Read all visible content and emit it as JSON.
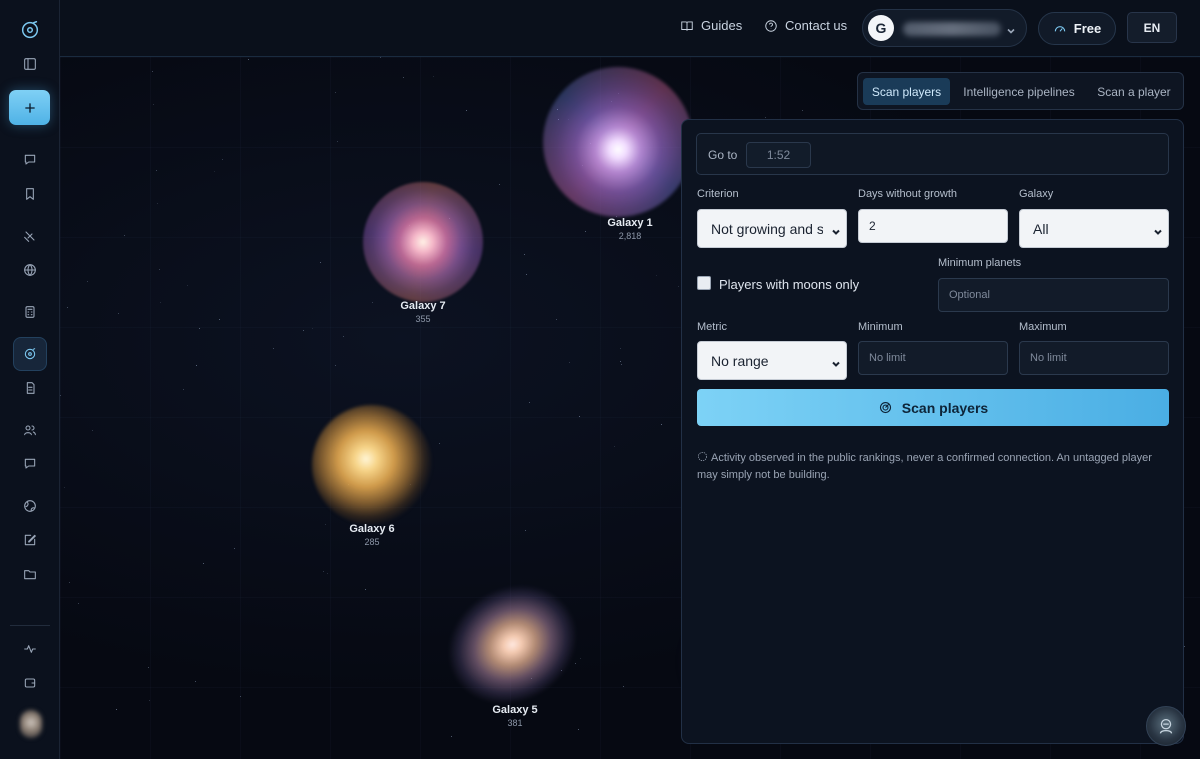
{
  "topbar": {
    "guides": "Guides",
    "contact": "Contact us",
    "account_initial": "G",
    "plan": "Free",
    "language": "EN"
  },
  "sidebar": {
    "items": [
      "logo-icon",
      "panel-toggle-icon",
      "new-button",
      "chat-icon",
      "bookmark-icon",
      "satellite-icon",
      "globe-icon",
      "calculator-icon",
      "galaxy-icon",
      "document-icon",
      "users-icon",
      "message-icon",
      "world-icon",
      "edit-icon",
      "folder-icon",
      "activity-icon",
      "wallet-icon"
    ],
    "active": "galaxy-icon"
  },
  "galaxies": [
    {
      "name": "Galaxy 1",
      "count": "2,818"
    },
    {
      "name": "Galaxy 7",
      "count": "355"
    },
    {
      "name": "Galaxy 6",
      "count": "285"
    },
    {
      "name": "Galaxy 5",
      "count": "381"
    }
  ],
  "tabs": [
    {
      "label": "Scan players",
      "active": true
    },
    {
      "label": "Intelligence pipelines",
      "active": false
    },
    {
      "label": "Scan a player",
      "active": false
    }
  ],
  "form": {
    "goto_label": "Go to",
    "goto_value": "1:52",
    "criterion_label": "Criterion",
    "criterion_value": "Not growing and s",
    "days_label": "Days without growth",
    "days_value": "2",
    "galaxy_label": "Galaxy",
    "galaxy_value": "All",
    "moons_label": "Players with moons only",
    "min_planets_label": "Minimum planets",
    "min_planets_placeholder": "Optional",
    "metric_label": "Metric",
    "metric_value": "No range",
    "minimum_label": "Minimum",
    "minimum_placeholder": "No limit",
    "maximum_label": "Maximum",
    "maximum_placeholder": "No limit",
    "scan_button": "Scan players",
    "note": "Activity observed in the public rankings, never a confirmed connection. An untagged player may simply not be building."
  },
  "colors": {
    "accent": "#5cbcec",
    "background": "#070b14"
  }
}
